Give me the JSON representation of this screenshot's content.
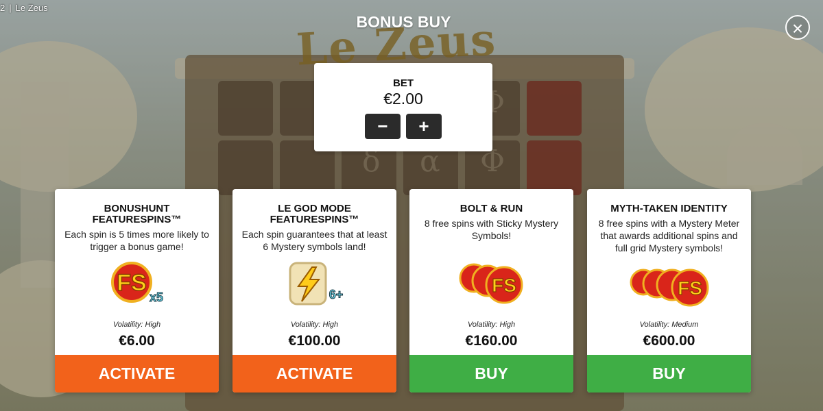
{
  "topbar": {
    "left_text": "2",
    "separator": "|",
    "game_name": "Le Zeus"
  },
  "background": {
    "logo": "Le Zeus"
  },
  "header": {
    "title": "BONUS BUY",
    "close_icon": "close-icon"
  },
  "bet": {
    "label": "BET",
    "value": "€2.00",
    "decrease_label": "−",
    "increase_label": "+"
  },
  "cards": [
    {
      "title": "BONUSHUNT FEATURESPINS™",
      "description": "Each spin is 5 times more likely to trigger a bonus game!",
      "icon": "fs-x5-icon",
      "icon_badge": "x5",
      "volatility": "Volatility: High",
      "price": "€6.00",
      "button_label": "ACTIVATE",
      "button_color": "#f2621b"
    },
    {
      "title": "LE GOD MODE FEATURESPINS™",
      "description": "Each spin guarantees that at least 6 Mystery symbols land!",
      "icon": "lightning-tablet-icon",
      "icon_badge": "6+",
      "volatility": "Volatility: High",
      "price": "€100.00",
      "button_label": "ACTIVATE",
      "button_color": "#f2621b"
    },
    {
      "title": "BOLT & RUN",
      "description": "8 free spins with Sticky Mystery Symbols!",
      "icon": "fs-triple-icon",
      "icon_badge": "FS",
      "volatility": "Volatility: High",
      "price": "€160.00",
      "button_label": "BUY",
      "button_color": "#3fae45"
    },
    {
      "title": "MYTH-TAKEN IDENTITY",
      "description": "8 free spins with a Mystery Meter that awards additional spins and full grid Mystery symbols!",
      "icon": "fs-quad-icon",
      "icon_badge": "FS",
      "volatility": "Volatility: Medium",
      "price": "€600.00",
      "button_label": "BUY",
      "button_color": "#3fae45"
    }
  ]
}
